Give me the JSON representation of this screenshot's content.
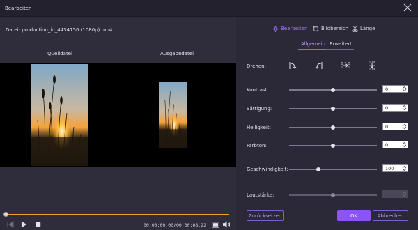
{
  "window": {
    "title": "Bearbeiten"
  },
  "left": {
    "file_label": "Datei: production_id_4434150 (1080p).mp4",
    "original_label": "Quelldatei",
    "output_label": "Ausgabedatei",
    "playback": {
      "time": "00:00:00.00/00:00:08.22",
      "progress": 0.0
    }
  },
  "tabs": [
    {
      "label": "Bearbeiten",
      "icon": "sparkle-icon",
      "active": true
    },
    {
      "label": "Bildbereich",
      "icon": "crop-icon",
      "active": false
    },
    {
      "label": "Länge",
      "icon": "scissors-icon",
      "active": false
    }
  ],
  "subtabs": [
    {
      "label": "Allgemein",
      "active": true
    },
    {
      "label": "Erweitert",
      "active": false
    }
  ],
  "rotate": {
    "label": "Drehen:",
    "icons": [
      "rotate-right-icon",
      "rotate-left-icon",
      "flip-horizontal-icon",
      "flip-vertical-icon"
    ]
  },
  "adjust": {
    "contrast": {
      "label": "Kontrast:",
      "value": "0",
      "level": 0.5
    },
    "saturation": {
      "label": "Sättigung:",
      "value": "0",
      "level": 0.5
    },
    "brightness": {
      "label": "Helligkeit:",
      "value": "0",
      "level": 0.5
    },
    "hue": {
      "label": "Farbton:",
      "value": "0",
      "level": 0.5
    },
    "speed": {
      "label": "Geschwindigkeit:",
      "value": "100",
      "level": 0.33
    },
    "volume": {
      "label": "Lautstärke:",
      "value": "",
      "level": 0.5,
      "disabled": true
    }
  },
  "buttons": {
    "reset": "Zurücksetzen",
    "ok": "OK",
    "cancel": "Abbrechen"
  },
  "colors": {
    "accent": "#8c53f5",
    "progress": "#f0a020"
  }
}
